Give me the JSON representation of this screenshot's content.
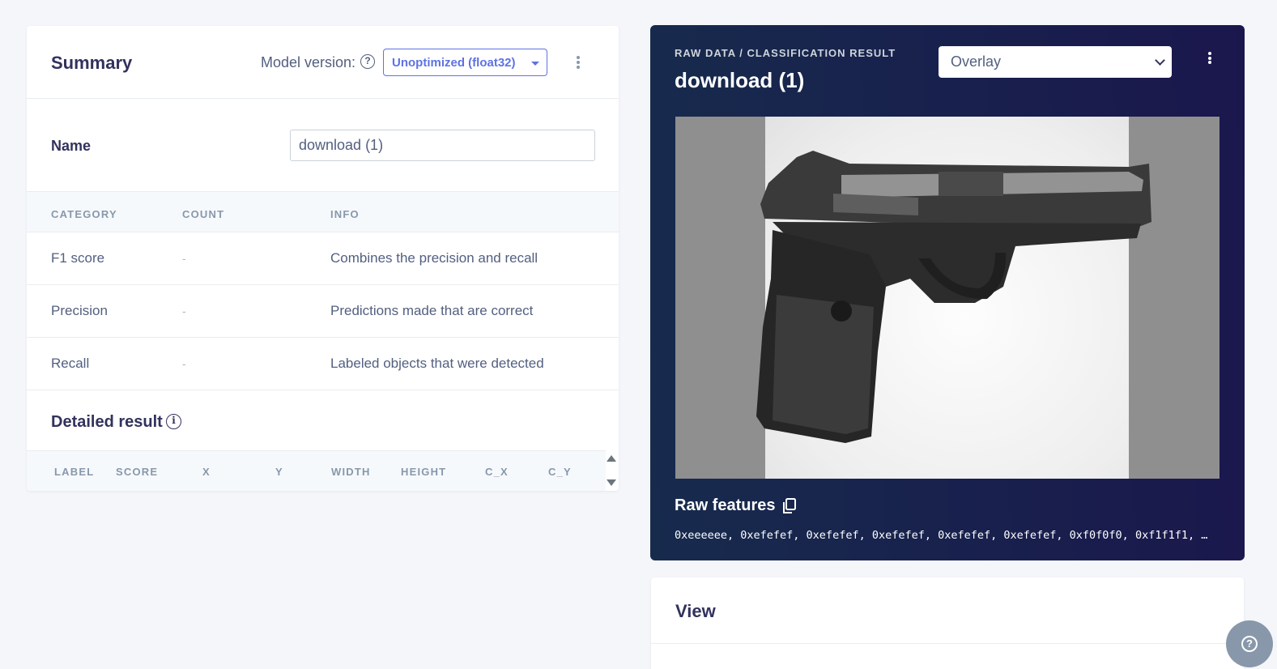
{
  "summary": {
    "title": "Summary",
    "model_version_label": "Model version:",
    "model_version_value": "Unoptimized (float32)"
  },
  "name_field": {
    "label": "Name",
    "value": "download (1)"
  },
  "metrics_table": {
    "headers": [
      "CATEGORY",
      "COUNT",
      "INFO"
    ],
    "rows": [
      {
        "category": "F1 score",
        "count": "-",
        "info": "Combines the precision and recall"
      },
      {
        "category": "Precision",
        "count": "-",
        "info": "Predictions made that are correct"
      },
      {
        "category": "Recall",
        "count": "-",
        "info": "Labeled objects that were detected"
      }
    ]
  },
  "detailed_result": {
    "title": "Detailed result",
    "headers": [
      "LABEL",
      "SCORE",
      "X",
      "Y",
      "WIDTH",
      "HEIGHT",
      "C_X",
      "C_Y"
    ]
  },
  "raw_data": {
    "breadcrumb": "RAW DATA / CLASSIFICATION RESULT",
    "title": "download (1)",
    "view_mode": "Overlay",
    "raw_features_title": "Raw features",
    "raw_features_values": "0xeeeeee, 0xefefef, 0xefefef, 0xefefef, 0xefefef, 0xefefef, 0xf0f0f0, 0xf1f1f1, …"
  },
  "view_card": {
    "title": "View"
  },
  "colors": {
    "accent": "#5e72e4",
    "dark_panel": "#172b4d",
    "text_primary": "#32325d",
    "text_muted": "#8898aa"
  },
  "icons": [
    "help-circle-icon",
    "caret-down-icon",
    "more-vertical-icon",
    "info-icon",
    "sort-up-icon",
    "sort-down-icon",
    "chevron-down-icon",
    "copy-icon",
    "help-fab-icon"
  ]
}
